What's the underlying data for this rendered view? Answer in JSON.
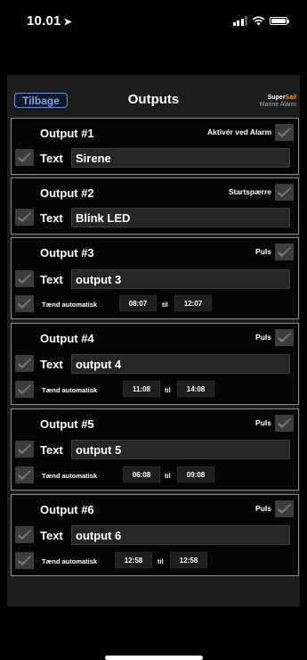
{
  "status": {
    "time": "10.01",
    "location_glyph": "➤"
  },
  "nav": {
    "back_label": "Tilbage",
    "title": "Outputs",
    "logo_super": "Super",
    "logo_sail": "Sail",
    "logo_sub": "Marine Alarm"
  },
  "outputs": [
    {
      "title": "Output #1",
      "option_label": "Aktivér ved Alarm",
      "text_label": "Text",
      "text_value": "Sirene"
    },
    {
      "title": "Output #2",
      "option_label": "Startspærre",
      "text_label": "Text",
      "text_value": "Blink LED"
    },
    {
      "title": "Output #3",
      "option_label": "Puls",
      "text_label": "Text",
      "text_value": "output 3",
      "auto_label": "Tænd automatisk",
      "from": "08:07",
      "til": "til",
      "to": "12:07"
    },
    {
      "title": "Output #4",
      "option_label": "Puls",
      "text_label": "Text",
      "text_value": "output 4",
      "auto_label": "Tænd automatisk",
      "from": "11:08",
      "til": "til",
      "to": "14:08"
    },
    {
      "title": "Output #5",
      "option_label": "Puls",
      "text_label": "Text",
      "text_value": "output 5",
      "auto_label": "Tænd automatisk",
      "from": "06:08",
      "til": "til",
      "to": "09:08"
    },
    {
      "title": "Output #6",
      "option_label": "Puls",
      "text_label": "Text",
      "text_value": "output 6",
      "auto_label": "Tænd automatisk",
      "from": "12:58",
      "til": "til",
      "to": "12:58"
    }
  ],
  "colors": {
    "accent": "#7fa3e0",
    "logo_orange": "#f0a020",
    "panel_border": "#8a8a8a",
    "checkbox_bg": "#3d3d3d"
  }
}
